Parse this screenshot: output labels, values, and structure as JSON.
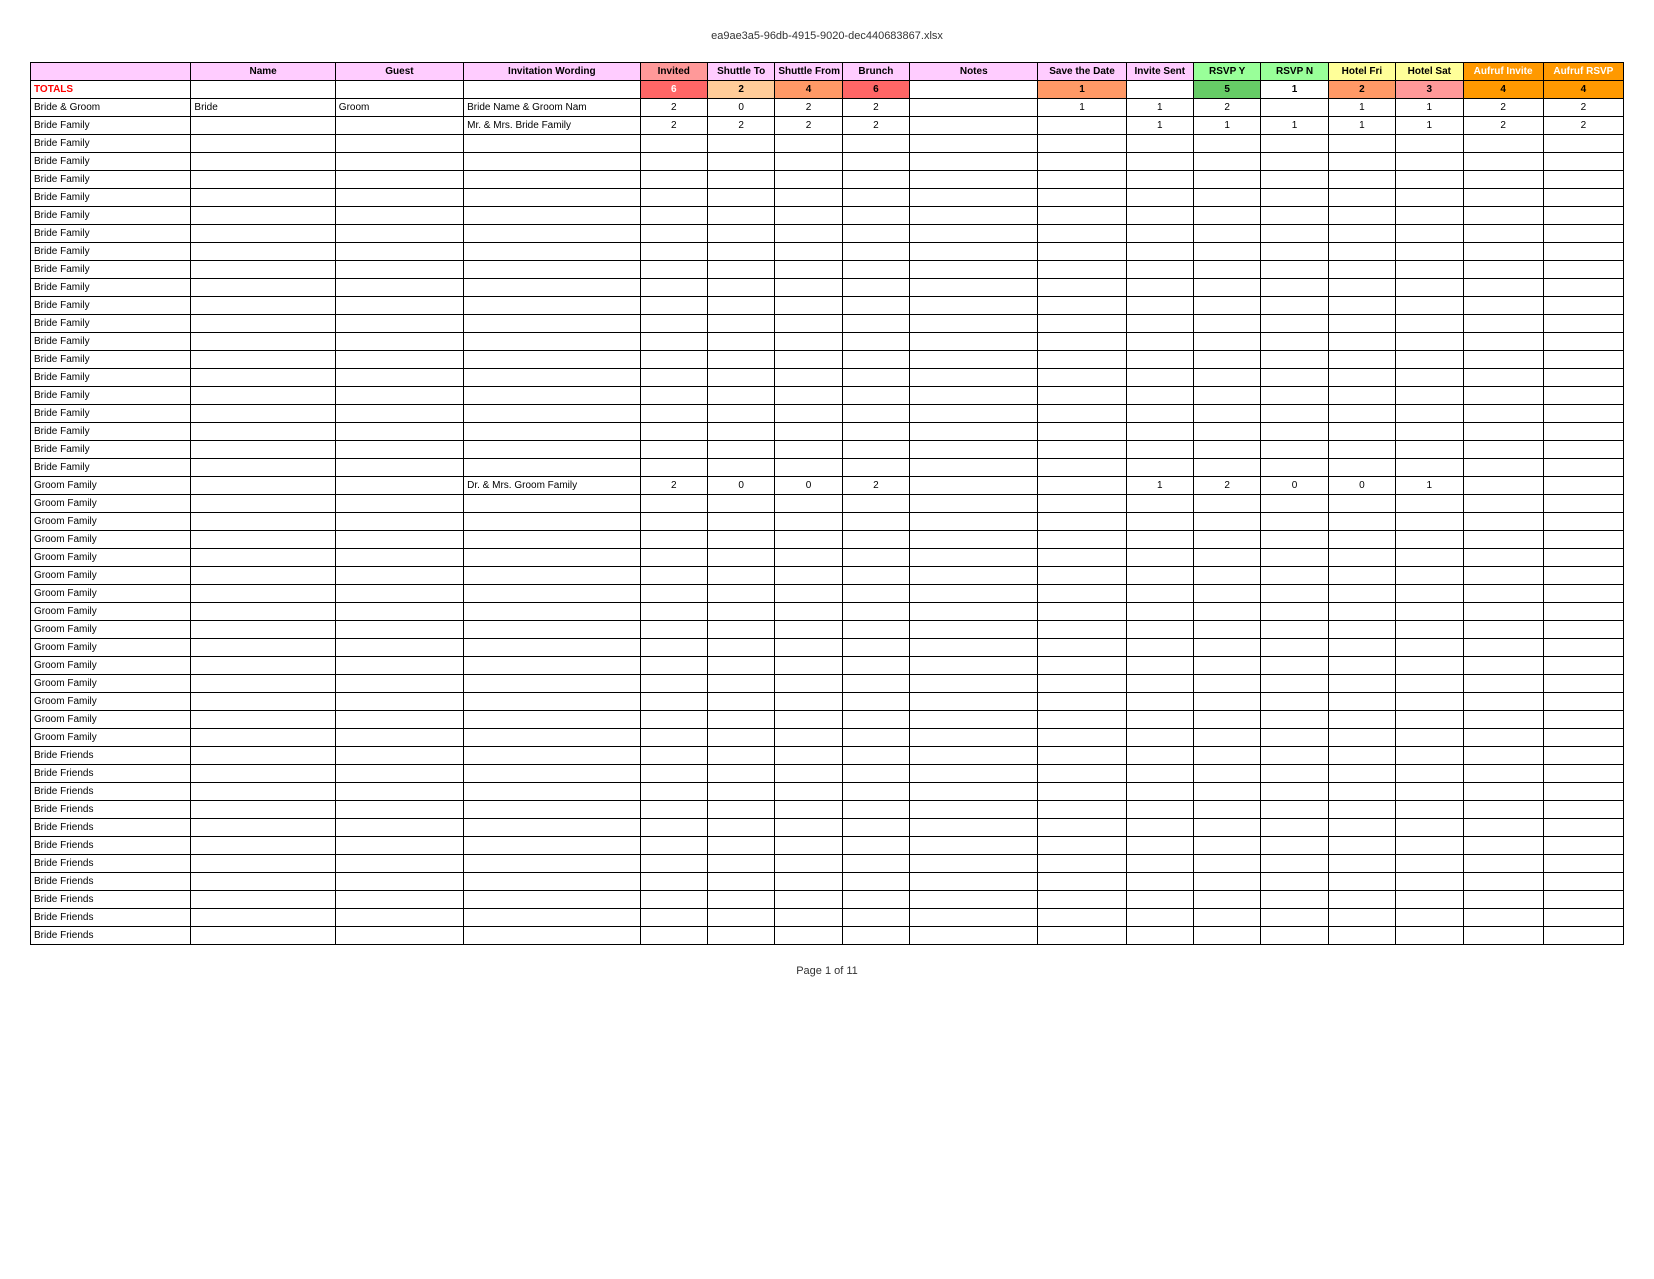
{
  "file": {
    "title": "ea9ae3a5-96db-4915-9020-dec440683867.xlsx"
  },
  "footer": {
    "text": "Page 1 of 11"
  },
  "headers": {
    "group": "",
    "name": "Name",
    "guest": "Guest",
    "invitation": "Invitation Wording",
    "invited": "Invited",
    "shuttle_to": "Shuttle To",
    "shuttle_from": "Shuttle From",
    "brunch": "Brunch",
    "notes": "Notes",
    "save_date": "Save the Date",
    "invite_sent": "Invite Sent",
    "rsvp_y": "RSVP Y",
    "rsvp_n": "RSVP N",
    "hotel_fri": "Hotel Fri",
    "hotel_sat": "Hotel Sat",
    "aufruf_invite": "Aufruf Invite",
    "aufruf_rsvp": "Aufruf RSVP"
  },
  "totals": {
    "label": "TOTALS",
    "invited": "6",
    "shuttle_to": "2",
    "shuttle_from": "4",
    "brunch": "6",
    "save_date": "1",
    "rsvp_y": "5",
    "rsvp_n": "1",
    "hotel_fri": "2",
    "hotel_sat": "3",
    "aufruf_invite": "4",
    "aufruf_rsvp": "4"
  },
  "rows": [
    {
      "group": "Bride & Groom",
      "name": "Bride",
      "guest": "Groom",
      "invitation": "Bride Name & Groom Nam",
      "invited": "2",
      "shuttle_to": "0",
      "shuttle_from": "2",
      "brunch": "2",
      "notes": "",
      "save_date": "1",
      "invite_sent": "1",
      "rsvp_y": "2",
      "rsvp_n": "",
      "hotel_fri": "1",
      "hotel_sat": "1",
      "aufruf_invite": "2",
      "aufruf_rsvp": "2"
    },
    {
      "group": "Bride Family",
      "name": "",
      "guest": "",
      "invitation": "Mr. & Mrs. Bride Family",
      "invited": "2",
      "shuttle_to": "2",
      "shuttle_from": "2",
      "brunch": "2",
      "notes": "",
      "save_date": "",
      "invite_sent": "1",
      "rsvp_y": "1",
      "rsvp_n": "1",
      "hotel_fri": "1",
      "hotel_sat": "1",
      "aufruf_invite": "2",
      "aufruf_rsvp": "2"
    }
  ],
  "bride_family_rows": 20,
  "groom_family_rows": 15,
  "bride_friends_rows": 11,
  "groom_family_first": {
    "group": "Groom Family",
    "invitation": "Dr. & Mrs. Groom Family",
    "invited": "2",
    "shuttle_to": "0",
    "shuttle_from": "0",
    "brunch": "2",
    "invite_sent": "1",
    "rsvp_y": "2",
    "rsvp_n": "0",
    "hotel_fri": "0",
    "hotel_sat": "1"
  }
}
